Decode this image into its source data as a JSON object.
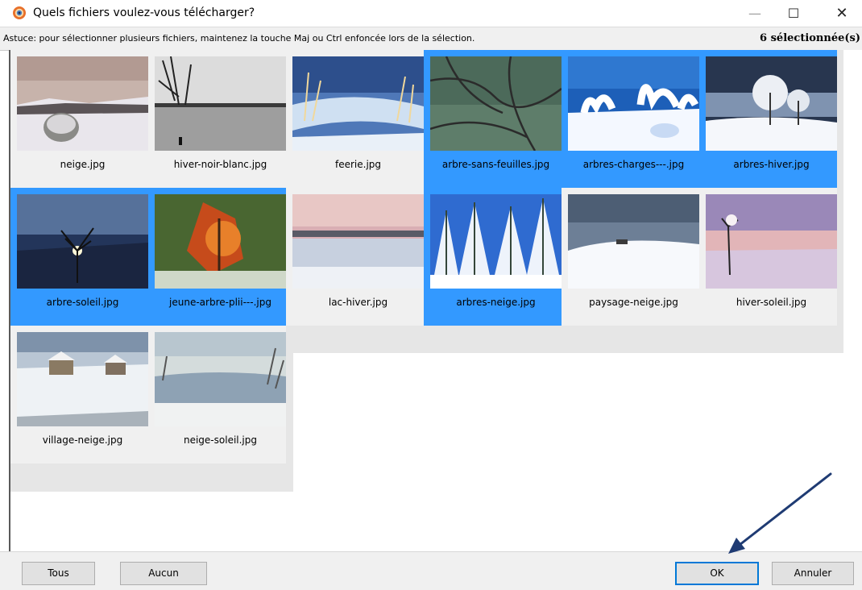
{
  "window": {
    "title": "Quels fichiers voulez-vous télécharger?",
    "minimize_glyph": "—",
    "maximize_glyph": "☐",
    "close_glyph": "✕"
  },
  "hint": {
    "text": "Astuce: pour sélectionner plusieurs fichiers, maintenez la touche Maj ou Ctrl enfoncée lors de la sélection.",
    "selected_count": "6 sélectionnée(s)"
  },
  "files": [
    {
      "name": "neige.jpg",
      "selected": false,
      "scene": "dusk-snow"
    },
    {
      "name": "hiver-noir-blanc.jpg",
      "selected": false,
      "scene": "bw-lake"
    },
    {
      "name": "feerie.jpg",
      "selected": false,
      "scene": "frost-river"
    },
    {
      "name": "arbre-sans-feuilles.jpg",
      "selected": true,
      "scene": "bare-branches"
    },
    {
      "name": "arbres-charges---.jpg",
      "selected": true,
      "scene": "snow-figures"
    },
    {
      "name": "arbres-hiver.jpg",
      "selected": true,
      "scene": "frost-trees"
    },
    {
      "name": "arbre-soleil.jpg",
      "selected": true,
      "scene": "sun-tree"
    },
    {
      "name": "jeune-arbre-plii---.jpg",
      "selected": true,
      "scene": "autumn-tree"
    },
    {
      "name": "lac-hiver.jpg",
      "selected": false,
      "scene": "pink-lake"
    },
    {
      "name": "arbres-neige.jpg",
      "selected": true,
      "scene": "snow-firs"
    },
    {
      "name": "paysage-neige.jpg",
      "selected": false,
      "scene": "snow-hills"
    },
    {
      "name": "hiver-soleil.jpg",
      "selected": false,
      "scene": "pink-sunset"
    },
    {
      "name": "village-neige.jpg",
      "selected": false,
      "scene": "snow-village"
    },
    {
      "name": "neige-soleil.jpg",
      "selected": false,
      "scene": "snow-marsh"
    }
  ],
  "buttons": {
    "all": "Tous",
    "none": "Aucun",
    "ok": "OK",
    "cancel": "Annuler"
  },
  "colors": {
    "selection": "#3399ff",
    "annotation_arrow": "#1f3b73"
  }
}
